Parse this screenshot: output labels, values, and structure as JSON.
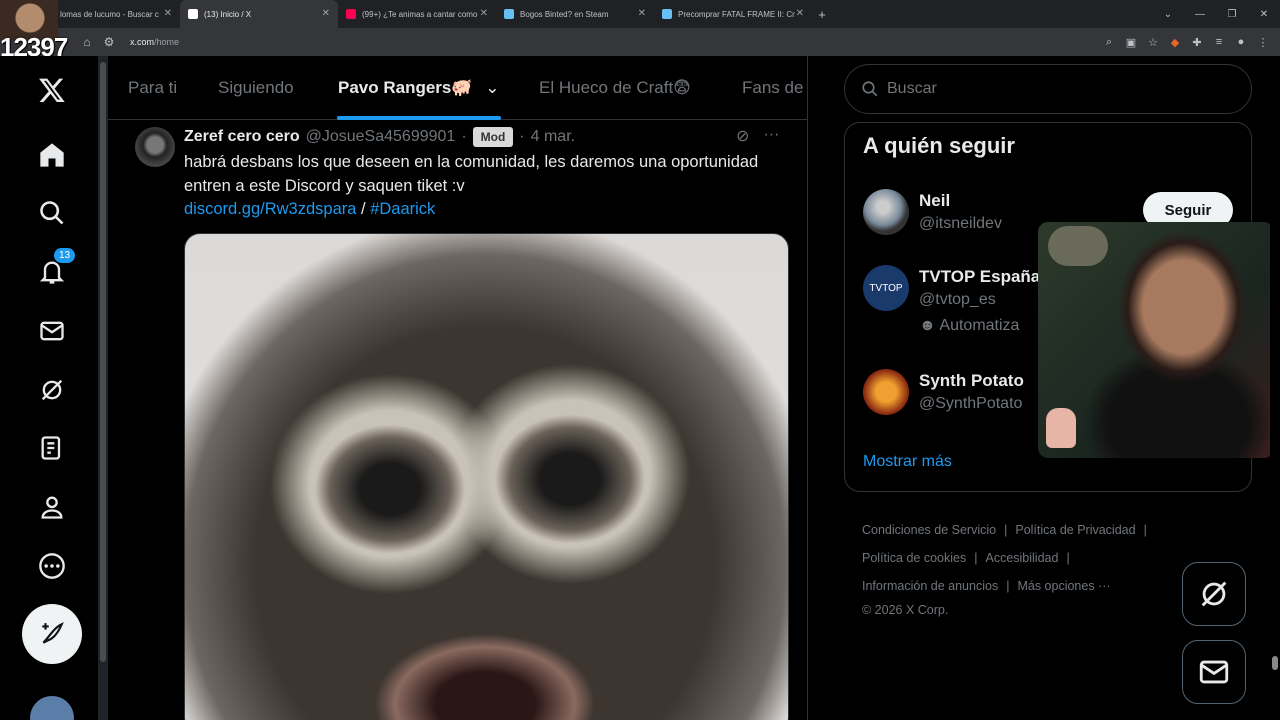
{
  "browser": {
    "tabs": [
      {
        "title": "lomas de lucumo - Buscar c",
        "fav": "#4285f4"
      },
      {
        "title": "(13) Inicio / X",
        "fav": "#ffffff"
      },
      {
        "title": "(99+) ¿Te animas a cantar como",
        "fav": "#ff0050"
      },
      {
        "title": "Bogos Binted? en Steam",
        "fav": "#66c0f4"
      },
      {
        "title": "Precomprar FATAL FRAME II: Cr",
        "fav": "#66c0f4"
      }
    ],
    "new_tab": "+",
    "url_host": "x.com",
    "url_path": "/home"
  },
  "stream_overlay": {
    "counter_text": "12397"
  },
  "leftnav": {
    "notifications_count": "13"
  },
  "main": {
    "tabs": [
      "Para ti",
      "Siguiendo",
      "Pavo Rangers🐖",
      "El Hueco de Craft😨",
      "Fans de"
    ],
    "post": {
      "name": "Zeref cero cero",
      "handle": "@JosueSa45699901",
      "mod": "Mod",
      "dot": "·",
      "date": "4 mar.",
      "text": "habrá desbans los que deseen en la comunidad, les daremos una oportunidad entren a este Discord y saquen tiket :v",
      "link": "discord.gg/Rw3zdspara",
      "slash": " / ",
      "hashtag": "#Daarick"
    }
  },
  "right": {
    "search_placeholder": "Buscar",
    "who_to_follow_title": "A quién seguir",
    "suggestions": [
      {
        "name": "Neil",
        "handle": "@itsneildev",
        "extra": ""
      },
      {
        "name": "TVTOP España",
        "handle": "@tvtop_es",
        "extra": "Automatiza"
      },
      {
        "name": "Synth Potato",
        "handle": "@SynthPotato",
        "extra": ""
      }
    ],
    "follow_label": "Seguir",
    "show_more": "Mostrar más",
    "footer": {
      "terms": "Condiciones de Servicio",
      "privacy": "Política de Privacidad",
      "cookies": "Política de cookies",
      "accessibility": "Accesibilidad",
      "ads_info": "Información de anuncios",
      "more": "Más opciones ···",
      "copyright": "© 2026 X Corp."
    }
  }
}
